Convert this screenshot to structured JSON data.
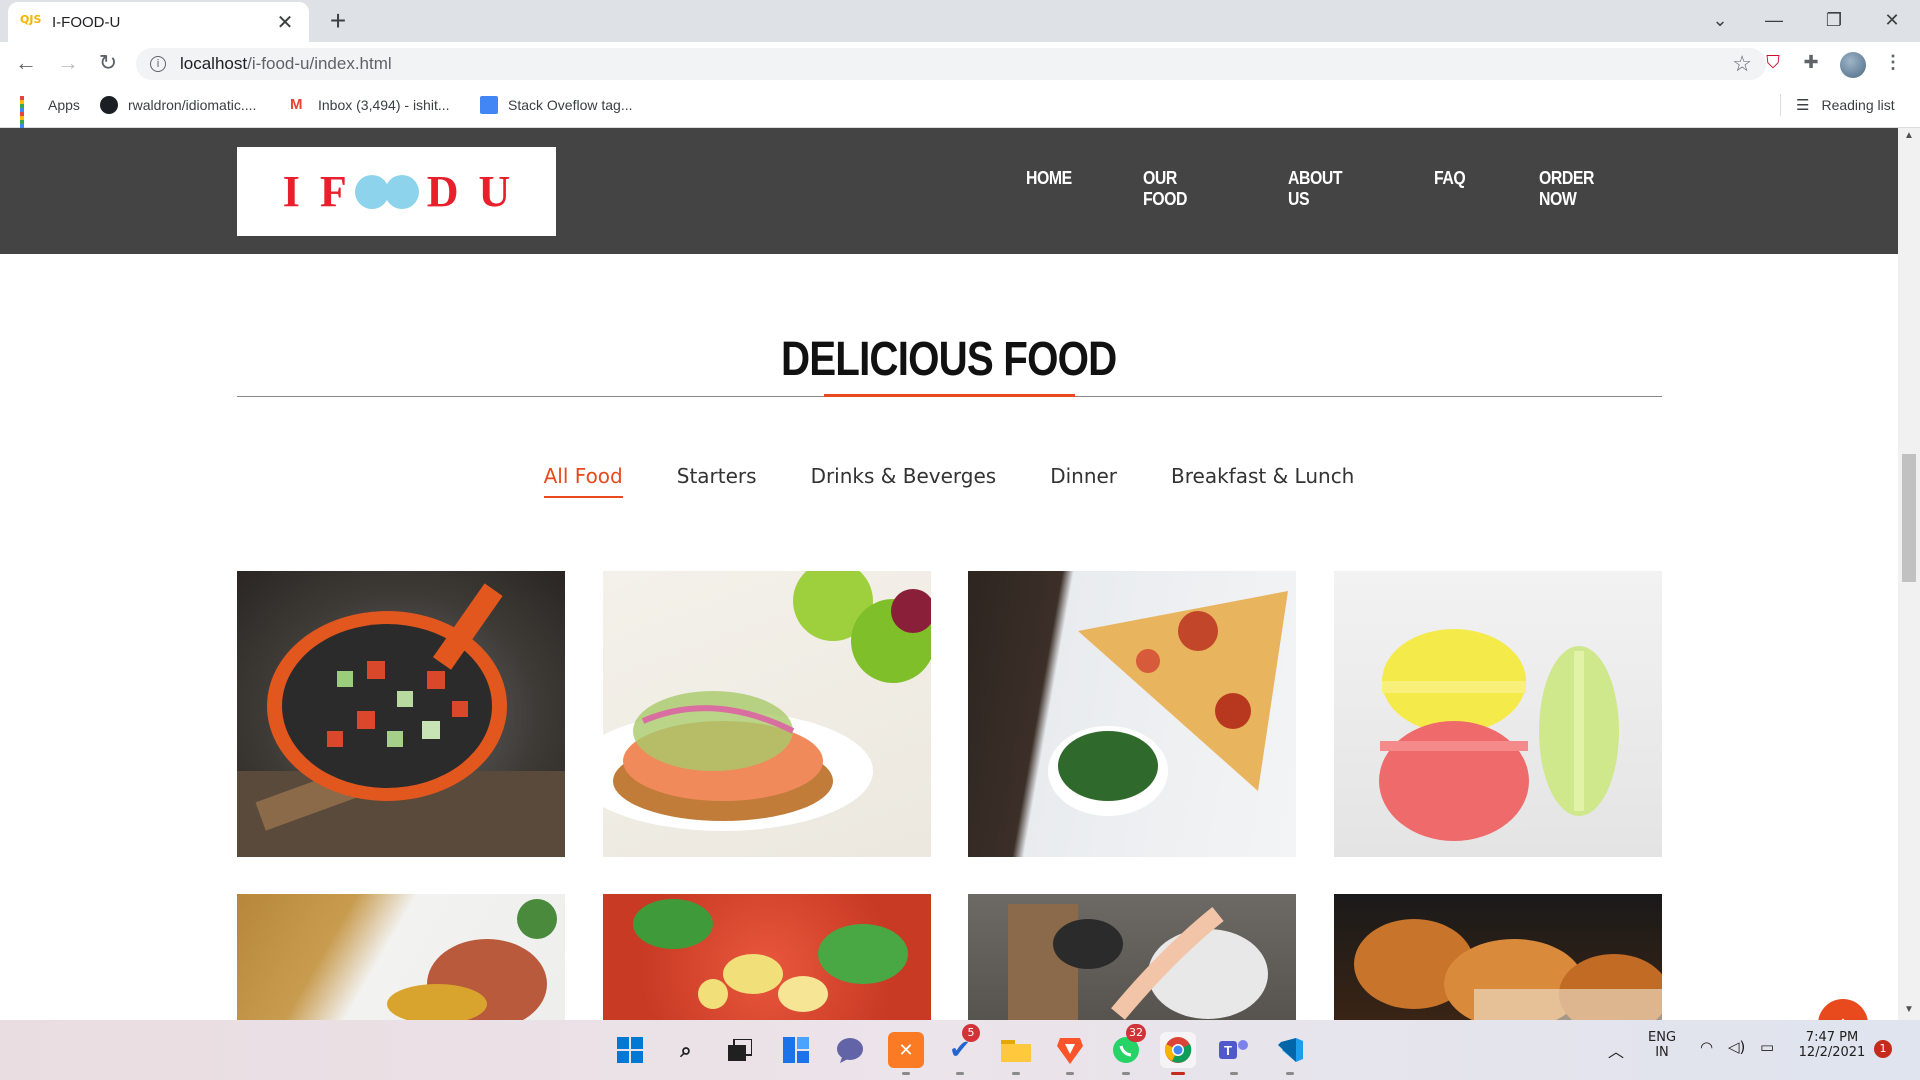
{
  "browser": {
    "tab_title": "I-FOOD-U",
    "tab_favicon": "QJS",
    "url_host": "localhost",
    "url_path": "/i-food-u/index.html",
    "bookmarks": [
      {
        "label": "Apps",
        "icon": "apps-grid-icon"
      },
      {
        "label": "rwaldron/idiomatic....",
        "icon": "github-icon"
      },
      {
        "label": "Inbox (3,494) - ishit...",
        "icon": "gmail-icon"
      },
      {
        "label": "Stack Oveflow tag...",
        "icon": "docs-icon"
      }
    ],
    "reading_list": "Reading list"
  },
  "site": {
    "logo_letters": [
      "I",
      "F",
      "D",
      "U"
    ],
    "nav": [
      "HOME",
      "OUR FOOD",
      "ABOUT US",
      "FAQ",
      "ORDER NOW"
    ],
    "section_title": "DELICIOUS FOOD",
    "filters": [
      {
        "label": "All Food",
        "active": true
      },
      {
        "label": "Starters",
        "active": false
      },
      {
        "label": "Drinks & Beverges",
        "active": false
      },
      {
        "label": "Dinner",
        "active": false
      },
      {
        "label": "Breakfast & Lunch",
        "active": false
      }
    ],
    "gallery": [
      {
        "name": "skillet-vegetables-photo"
      },
      {
        "name": "salmon-toast-photo"
      },
      {
        "name": "pizza-slice-photo"
      },
      {
        "name": "macarons-photo"
      },
      {
        "name": "rice-plate-photo"
      },
      {
        "name": "veggie-pizza-photo"
      },
      {
        "name": "dinner-table-photo"
      },
      {
        "name": "fried-chicken-photo"
      }
    ],
    "accent_color": "#e8491d",
    "header_color": "#444444"
  },
  "taskbar": {
    "badges": {
      "todo": "5",
      "whatsapp": "32"
    },
    "lang_top": "ENG",
    "lang_bottom": "IN",
    "time": "7:47 PM",
    "date": "12/2/2021",
    "notification_count": "1"
  }
}
